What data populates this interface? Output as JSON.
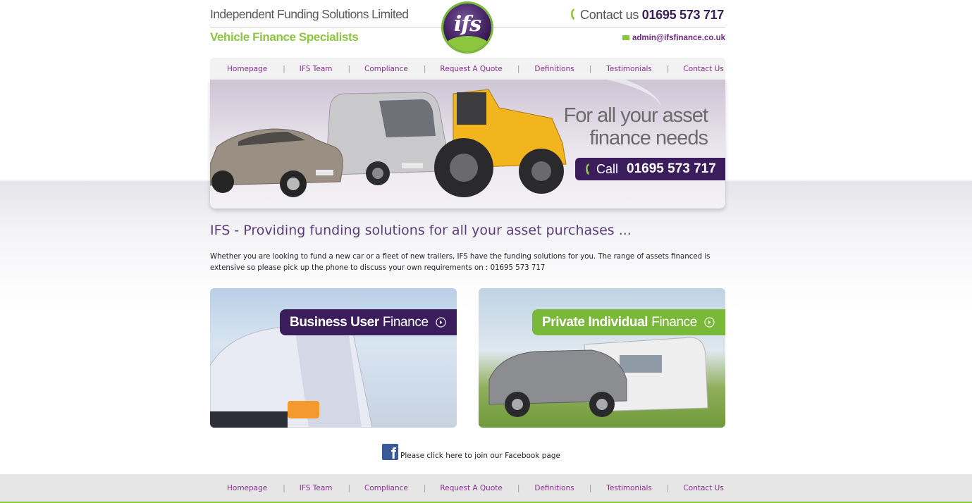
{
  "header": {
    "company_name": "Independent Funding Solutions Limited",
    "tagline": "Vehicle Finance Specialists",
    "logo_text": "ifs",
    "contact_prefix": "Contact us",
    "contact_phone": "01695 573 717",
    "email": "admin@ifsfinance.co.uk"
  },
  "nav": {
    "items": [
      "Homepage",
      "IFS Team",
      "Compliance",
      "Request A Quote",
      "Definitions",
      "Testimonials",
      "Contact Us"
    ],
    "separator": "|"
  },
  "banner": {
    "line1": "For all your asset",
    "line2": "finance needs",
    "call_label": "Call",
    "call_number": "01695 573 717"
  },
  "main": {
    "headline": "IFS - Providing funding solutions for all your asset purchases ...",
    "intro": "Whether you are looking to fund a new car or a fleet of new trailers, IFS have the funding solutions for you. The range of assets financed is extensive so please pick up the phone to discuss your own requirements on : 01695 573 717"
  },
  "promos": {
    "business": {
      "bold": "Business User",
      "light": "Finance"
    },
    "private": {
      "bold": "Private Individual",
      "light": "Finance"
    }
  },
  "facebook": {
    "text": "Please click here to join our Facebook page",
    "icon_letter": "f"
  },
  "footer": {
    "items": [
      "Homepage",
      "IFS Team",
      "Compliance",
      "Request A Quote",
      "Definitions",
      "Testimonials",
      "Contact Us"
    ]
  },
  "colors": {
    "purple": "#3b1d5c",
    "green": "#8cc63f",
    "link": "#8a2f93"
  }
}
